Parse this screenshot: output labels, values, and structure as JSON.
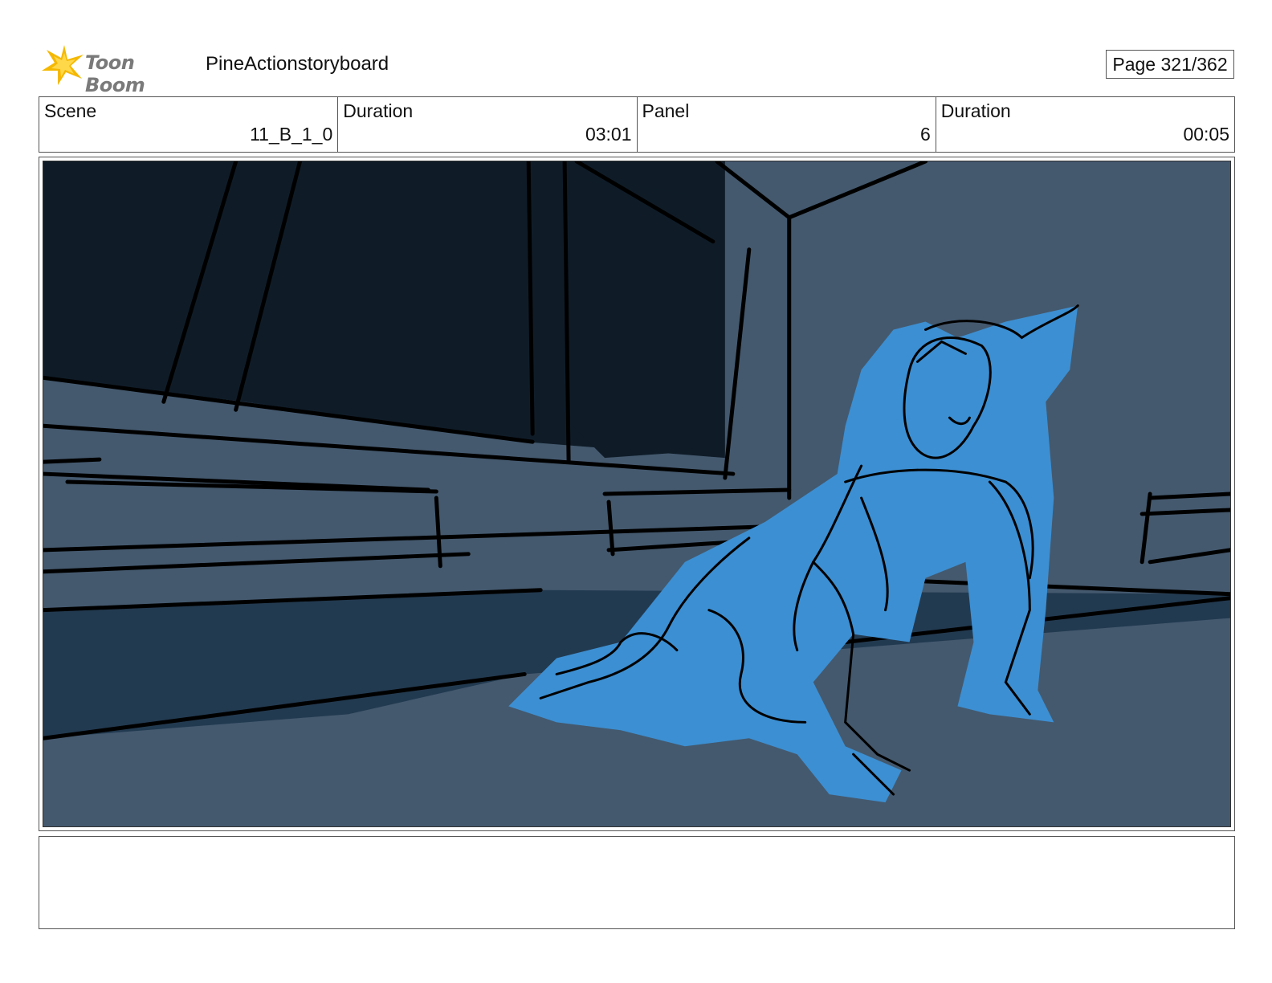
{
  "header": {
    "logo_text": "Toon Boom",
    "project_title": "PineActionstoryboard",
    "page_label": "Page 321/362"
  },
  "info": {
    "scene_label": "Scene",
    "scene_value": "11_B_1_0",
    "scene_duration_label": "Duration",
    "scene_duration_value": "03:01",
    "panel_label": "Panel",
    "panel_value": "6",
    "panel_duration_label": "Duration",
    "panel_duration_value": "00:05"
  },
  "notes": {
    "text": ""
  },
  "colors": {
    "logo_star": "#f5b800",
    "scene_background": "#44596e",
    "window_dark": "#0f1c28",
    "floor_shadow": "#223a50",
    "character_fill": "#3c8fd2",
    "ink": "#000000"
  }
}
